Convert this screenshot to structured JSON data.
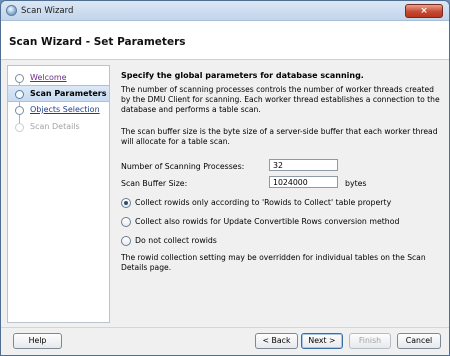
{
  "window": {
    "title": "Scan Wizard",
    "close_glyph": "×"
  },
  "header": {
    "title": "Scan Wizard - Set Parameters"
  },
  "nav": {
    "items": [
      {
        "label": "Welcome",
        "state": "visited"
      },
      {
        "label": "Scan Parameters",
        "state": "active"
      },
      {
        "label": "Objects Selection",
        "state": "link"
      },
      {
        "label": "Scan Details",
        "state": "disabled"
      }
    ]
  },
  "main": {
    "heading": "Specify the global parameters for database scanning.",
    "description_1": [
      "The number of scanning processes controls the number of worker threads created",
      "by the DMU Client for scanning. Each worker thread establishes a connection to the",
      "database and performs a table scan."
    ],
    "description_2": [
      "The scan buffer size is the byte size of a server-side buffer that each worker thread",
      "will allocate for a table scan."
    ],
    "fields": {
      "processes": {
        "label": "Number of Scanning Processes:",
        "value": "32"
      },
      "buffer": {
        "label": "Scan Buffer Size:",
        "value": "1024000",
        "unit": "bytes"
      }
    },
    "rowid_options": [
      {
        "label": "Collect rowids only according to 'Rowids to Collect' table property",
        "checked": true
      },
      {
        "label": "Collect also rowids for Update Convertible Rows conversion method",
        "checked": false
      },
      {
        "label": "Do not collect rowids",
        "checked": false
      }
    ],
    "note": [
      "The rowid collection setting may be overridden for individual tables on the Scan",
      "Details page."
    ]
  },
  "footer": {
    "help_label": "Help",
    "back_label": "< Back",
    "next_label": "Next >",
    "finish_label": "Finish",
    "cancel_label": "Cancel"
  }
}
